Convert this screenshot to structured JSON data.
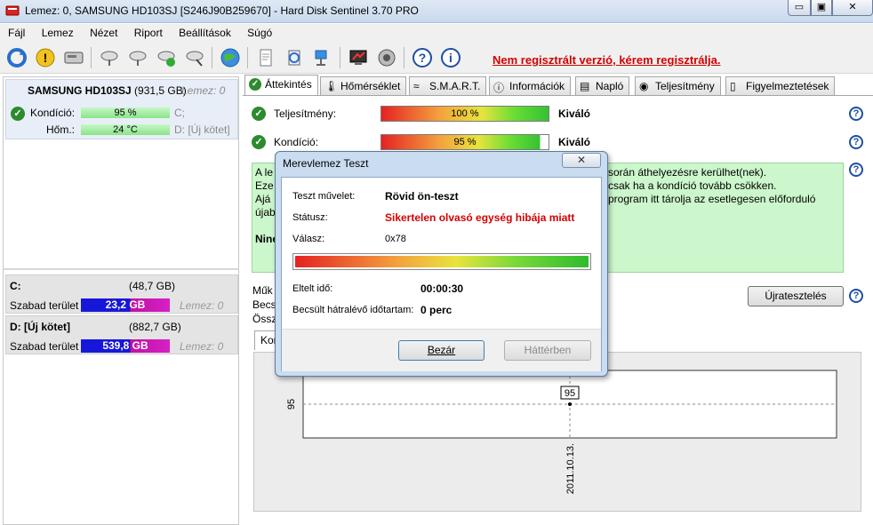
{
  "window": {
    "title": "Lemez: 0, SAMSUNG HD103SJ [S246J90B259670]  -  Hard Disk Sentinel 3.70 PRO",
    "min_glyph": "▭",
    "max_glyph": "▣",
    "close_glyph": "✕"
  },
  "menu": [
    "Fájl",
    "Lemez",
    "Nézet",
    "Riport",
    "Beállítások",
    "Súgó"
  ],
  "toolbar": {
    "register_notice": "Nem regisztrált verzió, kérem regisztrálja."
  },
  "disk": {
    "name": "SAMSUNG HD103SJ",
    "size": "(931,5 GB)",
    "lemez": "Lemez: 0",
    "kondicio_label": "Kondíció:",
    "kondicio_value": "95 %",
    "hom_label": "Hőm.:",
    "hom_value": "24 °C",
    "drive_c": "C;",
    "drive_d": "D: [Új kötet]"
  },
  "volumes": [
    {
      "name": "C:",
      "size": "(48,7 GB)",
      "free_label": "Szabad terület",
      "free_value": "23,2 GB",
      "lemez": "Lemez: 0"
    },
    {
      "name": "D: [Új kötet]",
      "size": "(882,7 GB)",
      "free_label": "Szabad terület",
      "free_value": "539,8 GB",
      "lemez": "Lemez: 0"
    }
  ],
  "tabs": [
    {
      "label": "Áttekintés",
      "icon": "check-icon",
      "active": true
    },
    {
      "label": "Hőmérséklet",
      "icon": "thermometer-icon"
    },
    {
      "label": "S.M.A.R.T.",
      "icon": "smart-icon"
    },
    {
      "label": "Információk",
      "icon": "info-icon"
    },
    {
      "label": "Napló",
      "icon": "log-icon"
    },
    {
      "label": "Teljesítmény",
      "icon": "performance-icon"
    },
    {
      "label": "Figyelmeztetések",
      "icon": "alerts-icon"
    }
  ],
  "overview": {
    "perf_label": "Teljesítmény:",
    "perf_value": "100 %",
    "perf_rating": "Kiváló",
    "cond_label": "Kondíció:",
    "cond_value": "95 %",
    "cond_rating": "Kiváló",
    "info_lines_left": [
      "A le",
      "Eze",
      "Ajá",
      "újab"
    ],
    "info_lines_right": [
      "során áthelyezésre kerülhet(nek).",
      "csak ha a kondíció tovább csökken.",
      "program itt tárolja az esetlegesen előforduló"
    ],
    "info_footer": "Nine",
    "side_labels": [
      "Műk",
      "Becs",
      "Össz"
    ],
    "retest_button": "Újratesztelés",
    "chart_tab": "Kon"
  },
  "chart_data": {
    "type": "line",
    "x": [
      "2011.10.13."
    ],
    "series": [
      {
        "values": [
          95
        ]
      }
    ],
    "ytick": "95",
    "data_label": "95",
    "grid": true
  },
  "dialog": {
    "title": "Merevlemez Teszt",
    "close_glyph": "✕",
    "test_label": "Teszt művelet:",
    "test_value": "Rövid ön-teszt",
    "status_label": "Státusz:",
    "status_value": "Sikertelen olvasó egység hibája miatt",
    "response_label": "Válasz:",
    "response_value": "0x78",
    "progress": 1.0,
    "elapsed_label": "Eltelt idő:",
    "elapsed_value": "00:00:30",
    "remaining_label": "Becsült hátralévő időtartam:",
    "remaining_value": "0 perc",
    "close_button": "Bezár",
    "background_button": "Háttérben"
  },
  "colors": {
    "register_red": "#d40000",
    "status_red": "#d40000",
    "info_green": "#ccf7cc",
    "free_blue": "#1717d9",
    "free_magenta": "#d620c8"
  }
}
